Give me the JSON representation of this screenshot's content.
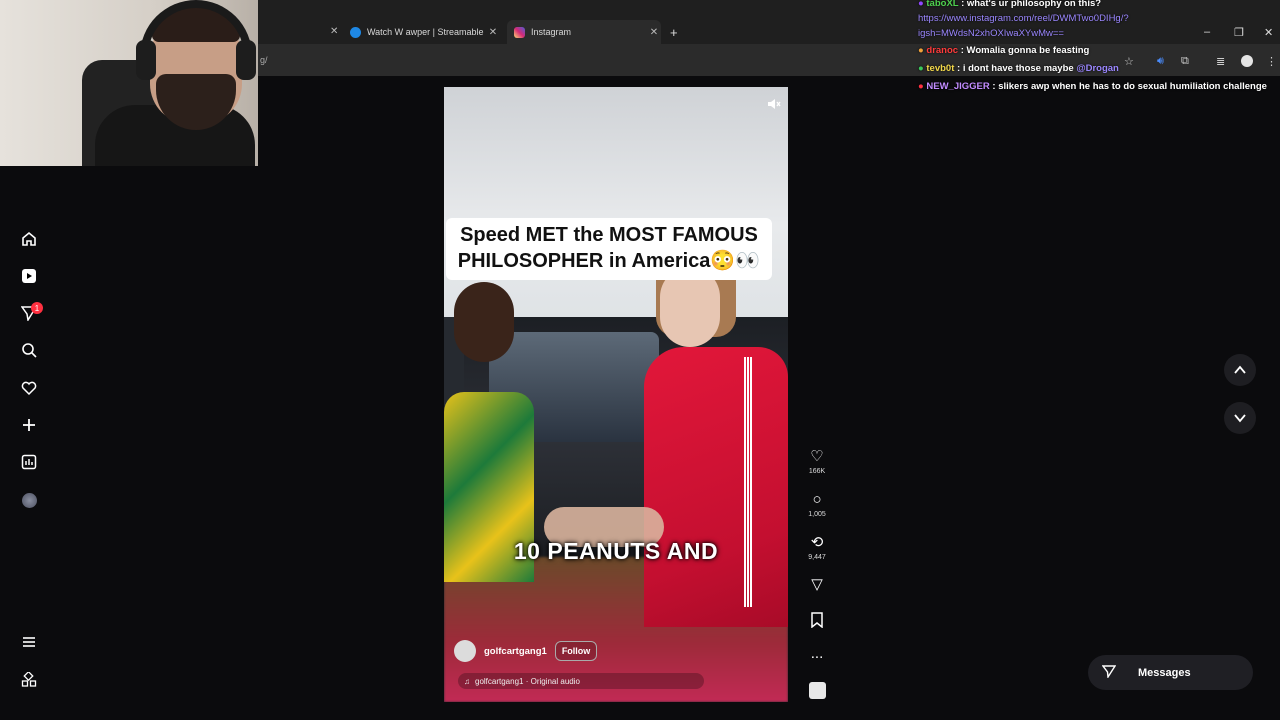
{
  "browser": {
    "tabs": [
      {
        "label": "Watch W awper | Streamable"
      },
      {
        "label": "Instagram"
      }
    ],
    "url_fragment": "g/"
  },
  "chat": {
    "messages": [
      {
        "user": "taboXL",
        "text": ": what's ur philosophy on this?",
        "user_color": "#4fd14f"
      },
      {
        "user": "dranoc",
        "text": ": Womalia gonna be feasting",
        "user_color": "#ff3b3b"
      },
      {
        "user": "tevb0t",
        "text": ": i dont have those maybe",
        "mention": "@Drogan",
        "user_color": "#f2d84a"
      },
      {
        "user": "NEW_JIGGER",
        "text": ": slikers awp when he has to do sexual humiliation challenge",
        "user_color": "#c28cff"
      }
    ],
    "link_line1": "https://www.instagram.com/reel/DWMTwo0DIHg/?",
    "link_line2": "igsh=MWdsN2xhOXIwaXYwMw=="
  },
  "sidebar": {
    "items": [
      "home-icon",
      "reels-icon",
      "messages-icon",
      "search-icon",
      "heart-icon",
      "create-icon",
      "dashboard-icon",
      "profile-icon"
    ],
    "notification_count": "1",
    "bottom_items": [
      "menu-icon",
      "apps-icon"
    ]
  },
  "video": {
    "title": "Speed MET the MOST FAMOUS PHILOSOPHER in America😳👀",
    "subtitle": "10 PEANUTS AND",
    "author": "golfcartgang1",
    "follow_label": "Follow",
    "audio": "golfcartgang1 · Original audio"
  },
  "actions": {
    "likes": "166K",
    "comments": "1,005",
    "reposts": "9,447",
    "more": "..."
  },
  "messages_button": {
    "label": "Messages"
  },
  "colors": {
    "page_bg": "#0b0b0d",
    "accent_red": "#ff3040"
  }
}
